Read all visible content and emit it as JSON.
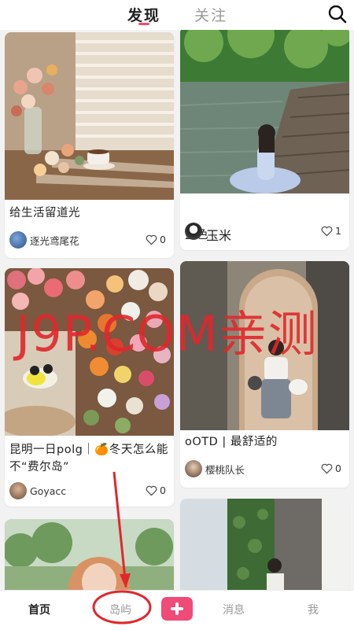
{
  "header": {
    "tabs": [
      {
        "label": "发现",
        "active": true
      },
      {
        "label": "关注",
        "active": false
      }
    ]
  },
  "feed": {
    "posts": [
      {
        "title": "给生活留道光",
        "author": "逐光鸢尾花",
        "likes": "0"
      },
      {
        "title": "蓝色",
        "author": "玉米",
        "likes": "1"
      },
      {
        "title": "昆明一日polg｜🍊冬天怎么能不“费尔岛”",
        "author": "Goyacc",
        "likes": "0"
      },
      {
        "title": "oOTD | 最舒适的",
        "author": "樱桃队长",
        "likes": "0"
      }
    ]
  },
  "bottom_nav": {
    "items": [
      "首页",
      "岛屿",
      "消息",
      "我"
    ],
    "active": "首页"
  },
  "watermark": "J9P.COM亲测",
  "colors": {
    "accent": "#f04b78",
    "annotation": "#e0282c"
  }
}
